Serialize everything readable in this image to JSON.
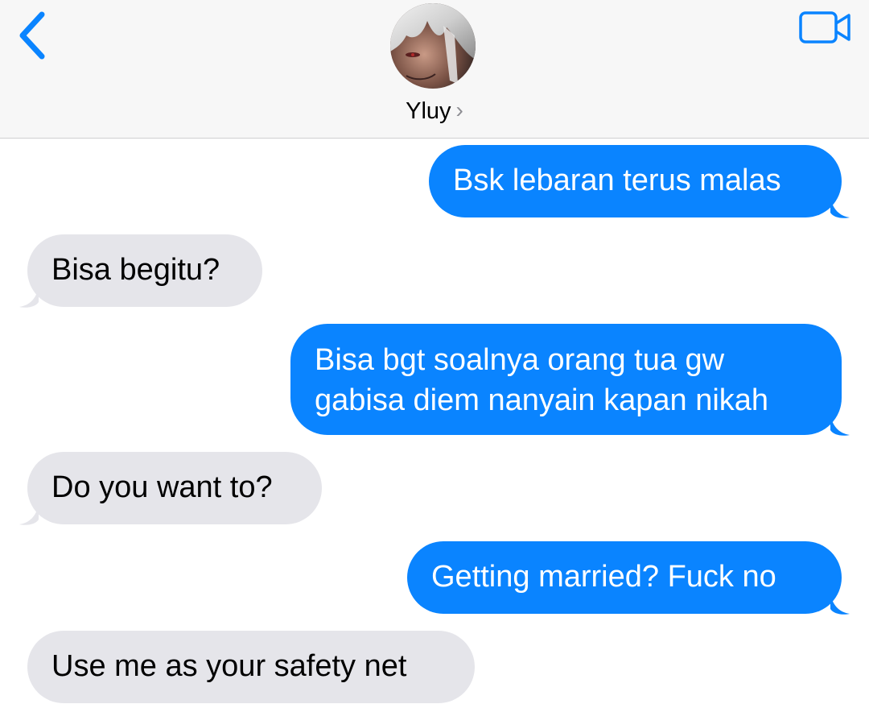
{
  "header": {
    "contact_name": "Yluy",
    "back_icon": "chevron-left-icon",
    "video_icon": "video-camera-icon",
    "accent_color": "#0a84ff"
  },
  "messages": [
    {
      "direction": "sent",
      "text": "Bsk lebaran terus malas"
    },
    {
      "direction": "received",
      "text": "Bisa begitu?"
    },
    {
      "direction": "sent",
      "lines": [
        "Bisa bgt soalnya orang tua gw",
        "gabisa diem nanyain kapan nikah"
      ]
    },
    {
      "direction": "received",
      "text": "Do you want to?"
    },
    {
      "direction": "sent",
      "text": "Getting married? Fuck no"
    },
    {
      "direction": "received",
      "text": "Use me as your safety net"
    }
  ],
  "colors": {
    "sent_bubble": "#0a84ff",
    "received_bubble": "#e5e5ea"
  }
}
